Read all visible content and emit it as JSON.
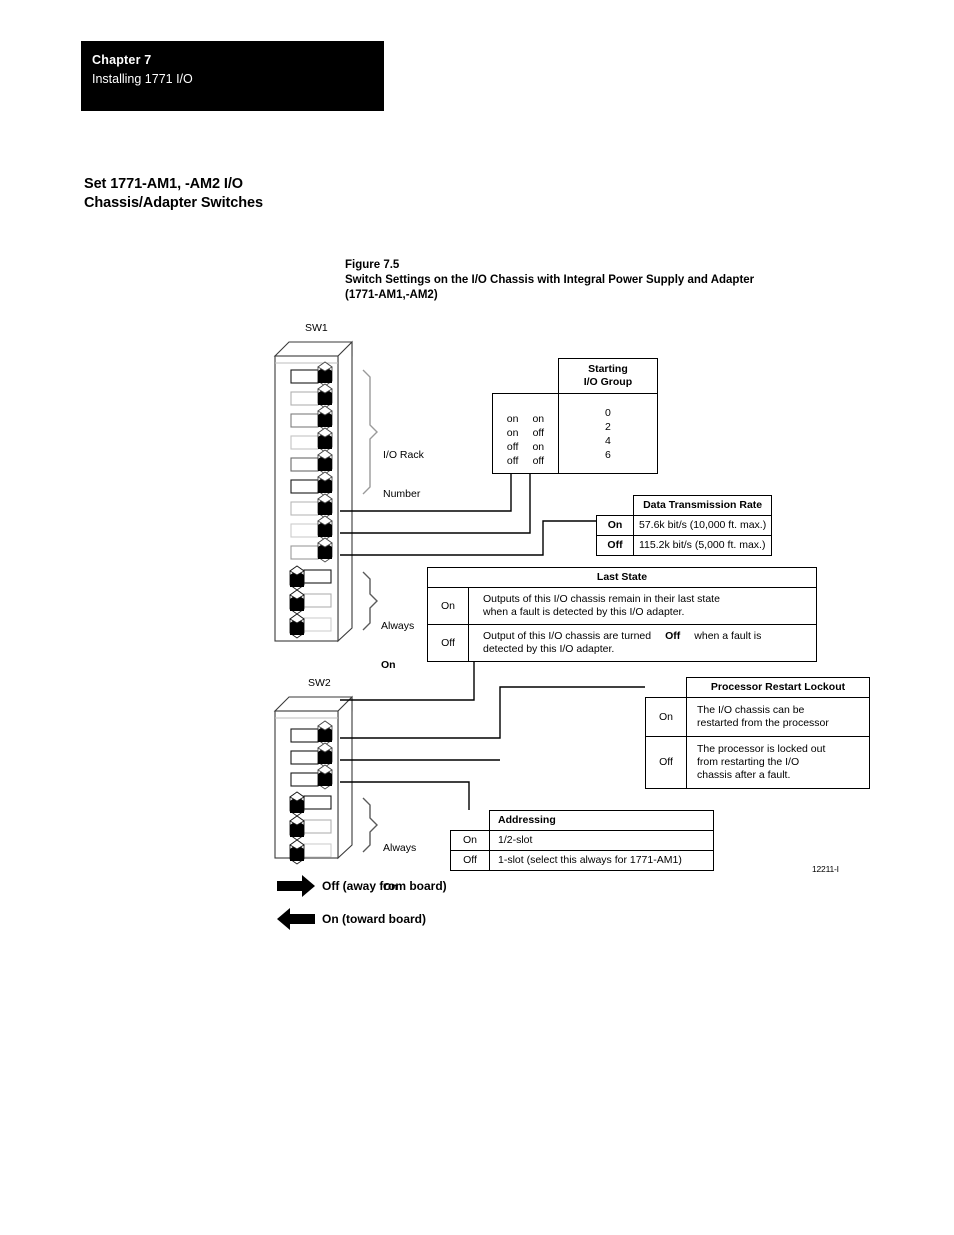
{
  "chapter": {
    "label": "Chapter  7",
    "subtitle": "Installing 1771 I/O"
  },
  "section": {
    "heading_line1": "Set 1771-AM1, -AM2 I/O",
    "heading_line2": "Chassis/Adapter Switches"
  },
  "figure": {
    "number": "Figure 7.5",
    "title_line1": "Switch Settings on the I/O Chassis with Integral Power Supply and Adapter",
    "title_line2": "(1771-AM1,-AM2)",
    "figure_id": "12211-I"
  },
  "switch_banks": [
    {
      "name": "SW1",
      "label": "SW1",
      "switch_count": 12,
      "positions": [
        "off",
        "off",
        "off",
        "off",
        "off",
        "off",
        "off",
        "off",
        "off",
        "on",
        "on",
        "on"
      ]
    },
    {
      "name": "SW2",
      "label": "SW2",
      "switch_count": 6,
      "positions": [
        "off",
        "off",
        "off",
        "on",
        "on",
        "on"
      ]
    }
  ],
  "bracket_labels": {
    "io_rack_number_line1": "I/O Rack",
    "io_rack_number_line2": "Number",
    "always_line": "Always",
    "on_line": "On"
  },
  "tables": {
    "starting_io_group": {
      "header": "Starting\nI/O Group",
      "switch_col_a": "on\non\noff\noff",
      "switch_col_b": "on\noff\non\noff",
      "values": "0\n2\n4\n6"
    },
    "data_transmission_rate": {
      "header": "Data Transmission Rate",
      "rows": [
        {
          "state": "On",
          "description": "57.6k bit/s (10,000 ft. max.)"
        },
        {
          "state": "Off",
          "description": "115.2k bit/s (5,000 ft. max.)"
        }
      ]
    },
    "last_state": {
      "header": "Last State",
      "rows": [
        {
          "state": "On",
          "desc_part1": "Outputs of this I/O chassis remain in their last state",
          "desc_part2": "when a fault is detected by this I/O adapter.",
          "emphasis": ""
        },
        {
          "state": "Off",
          "desc_part1": "Output of this I/O chassis are turned",
          "emphasis": "Off",
          "desc_part2": "when a fault is",
          "desc_part3": "detected by this I/O adapter."
        }
      ]
    },
    "processor_restart_lockout": {
      "header": "Processor Restart Lockout",
      "rows": [
        {
          "state": "On",
          "description": "The I/O chassis can be\nrestarted from the processor"
        },
        {
          "state": "Off",
          "description": "The processor is locked out\nfrom restarting the I/O\nchassis after a fault."
        }
      ]
    },
    "addressing": {
      "header": "Addressing",
      "rows": [
        {
          "state": "On",
          "description": "1/2-slot"
        },
        {
          "state": "Off",
          "description": "1-slot (select this always for 1771-AM1)"
        }
      ]
    }
  },
  "legend": {
    "off_label": "Off (away from board)",
    "on_label": "On (toward board)"
  },
  "colors": {
    "ink": "#000000",
    "paper": "#ffffff",
    "header_bar": "#000000",
    "switch_edge": "#8a8a8a"
  }
}
